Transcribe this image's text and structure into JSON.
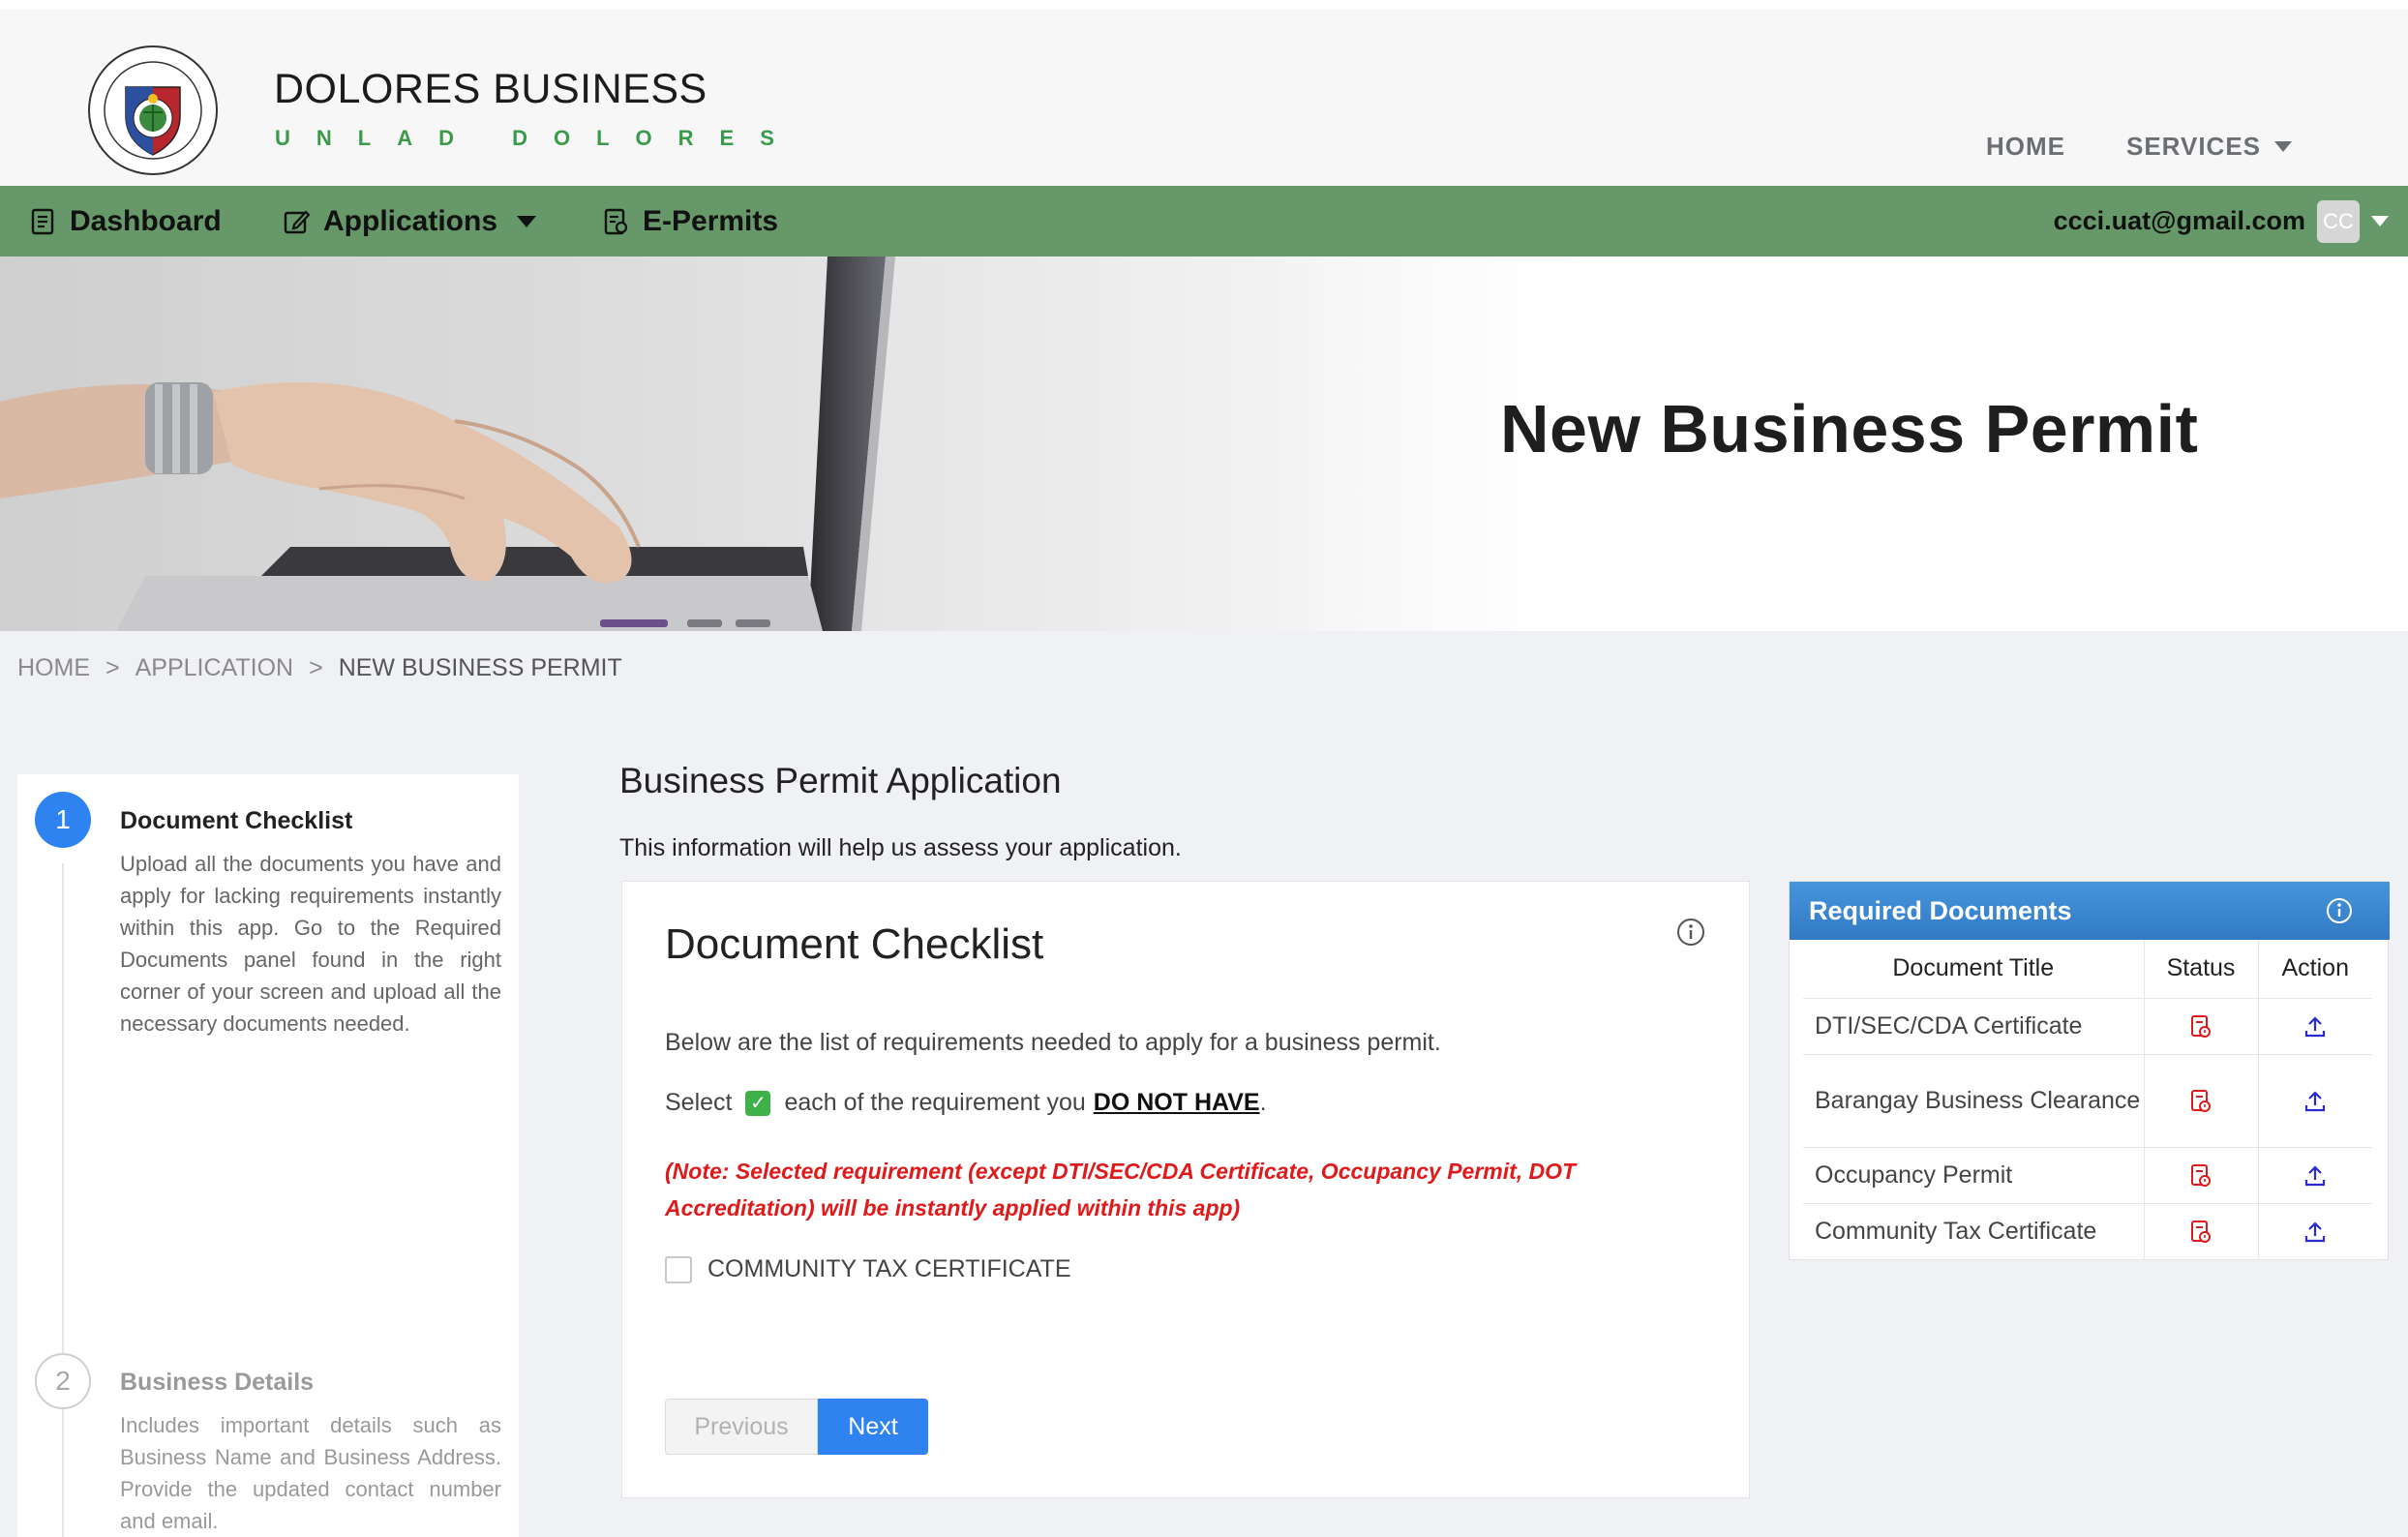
{
  "header": {
    "brand_title": "DOLORES BUSINESS",
    "brand_subtitle": "UNLAD DOLORES",
    "logo_icon": "municipal-seal-icon",
    "nav": {
      "home": "HOME",
      "services": "SERVICES"
    }
  },
  "greennav": {
    "dashboard": "Dashboard",
    "applications": "Applications",
    "epermits": "E-Permits",
    "user_email": "ccci.uat@gmail.com",
    "avatar_initials": "CC"
  },
  "hero": {
    "title": "New Business Permit"
  },
  "breadcrumb": {
    "home": "HOME",
    "sep1": ">",
    "application": "APPLICATION",
    "sep2": ">",
    "current": "NEW BUSINESS PERMIT"
  },
  "steps": [
    {
      "number": "1",
      "title": "Document Checklist",
      "description": "Upload all the documents you have and apply for lacking requirements instantly within this app. Go to the Required Documents panel found in the right corner of your screen and upload all the necessary documents needed."
    },
    {
      "number": "2",
      "title": "Business Details",
      "description": "Includes important details such as Business Name and Business Address. Provide the updated contact number and email."
    }
  ],
  "main": {
    "title": "Business Permit Application",
    "subtitle": "This information will help us assess your application."
  },
  "checklist": {
    "title": "Document Checklist",
    "intro": "Below are the list of requirements needed to apply for a business permit.",
    "select_prefix": "Select",
    "select_mid": "each of the requirement you",
    "select_emphasis": "DO NOT HAVE",
    "select_suffix": ".",
    "note": "(Note: Selected requirement (except DTI/SEC/CDA Certificate, Occupancy Permit, DOT Accreditation) will be instantly applied within this app)",
    "checkbox_label": "COMMUNITY TAX CERTIFICATE",
    "checkbox_checked": false,
    "prev_label": "Previous",
    "next_label": "Next"
  },
  "required_documents": {
    "title": "Required Documents",
    "columns": [
      "Document Title",
      "Status",
      "Action"
    ],
    "rows": [
      {
        "title": "DTI/SEC/CDA Certificate",
        "status_icon": "document-pending-icon",
        "action_icon": "upload-icon"
      },
      {
        "title": "Barangay Business Clearance",
        "status_icon": "document-pending-icon",
        "action_icon": "upload-icon"
      },
      {
        "title": "Occupancy Permit",
        "status_icon": "document-pending-icon",
        "action_icon": "upload-icon"
      },
      {
        "title": "Community Tax Certificate",
        "status_icon": "document-pending-icon",
        "action_icon": "upload-icon"
      }
    ]
  },
  "colors": {
    "nav_green": "#669869",
    "primary_blue": "#2e83f0",
    "note_red": "#e0191a",
    "brand_green": "#3b9a4a",
    "panel_blue": "#3a86d0"
  }
}
